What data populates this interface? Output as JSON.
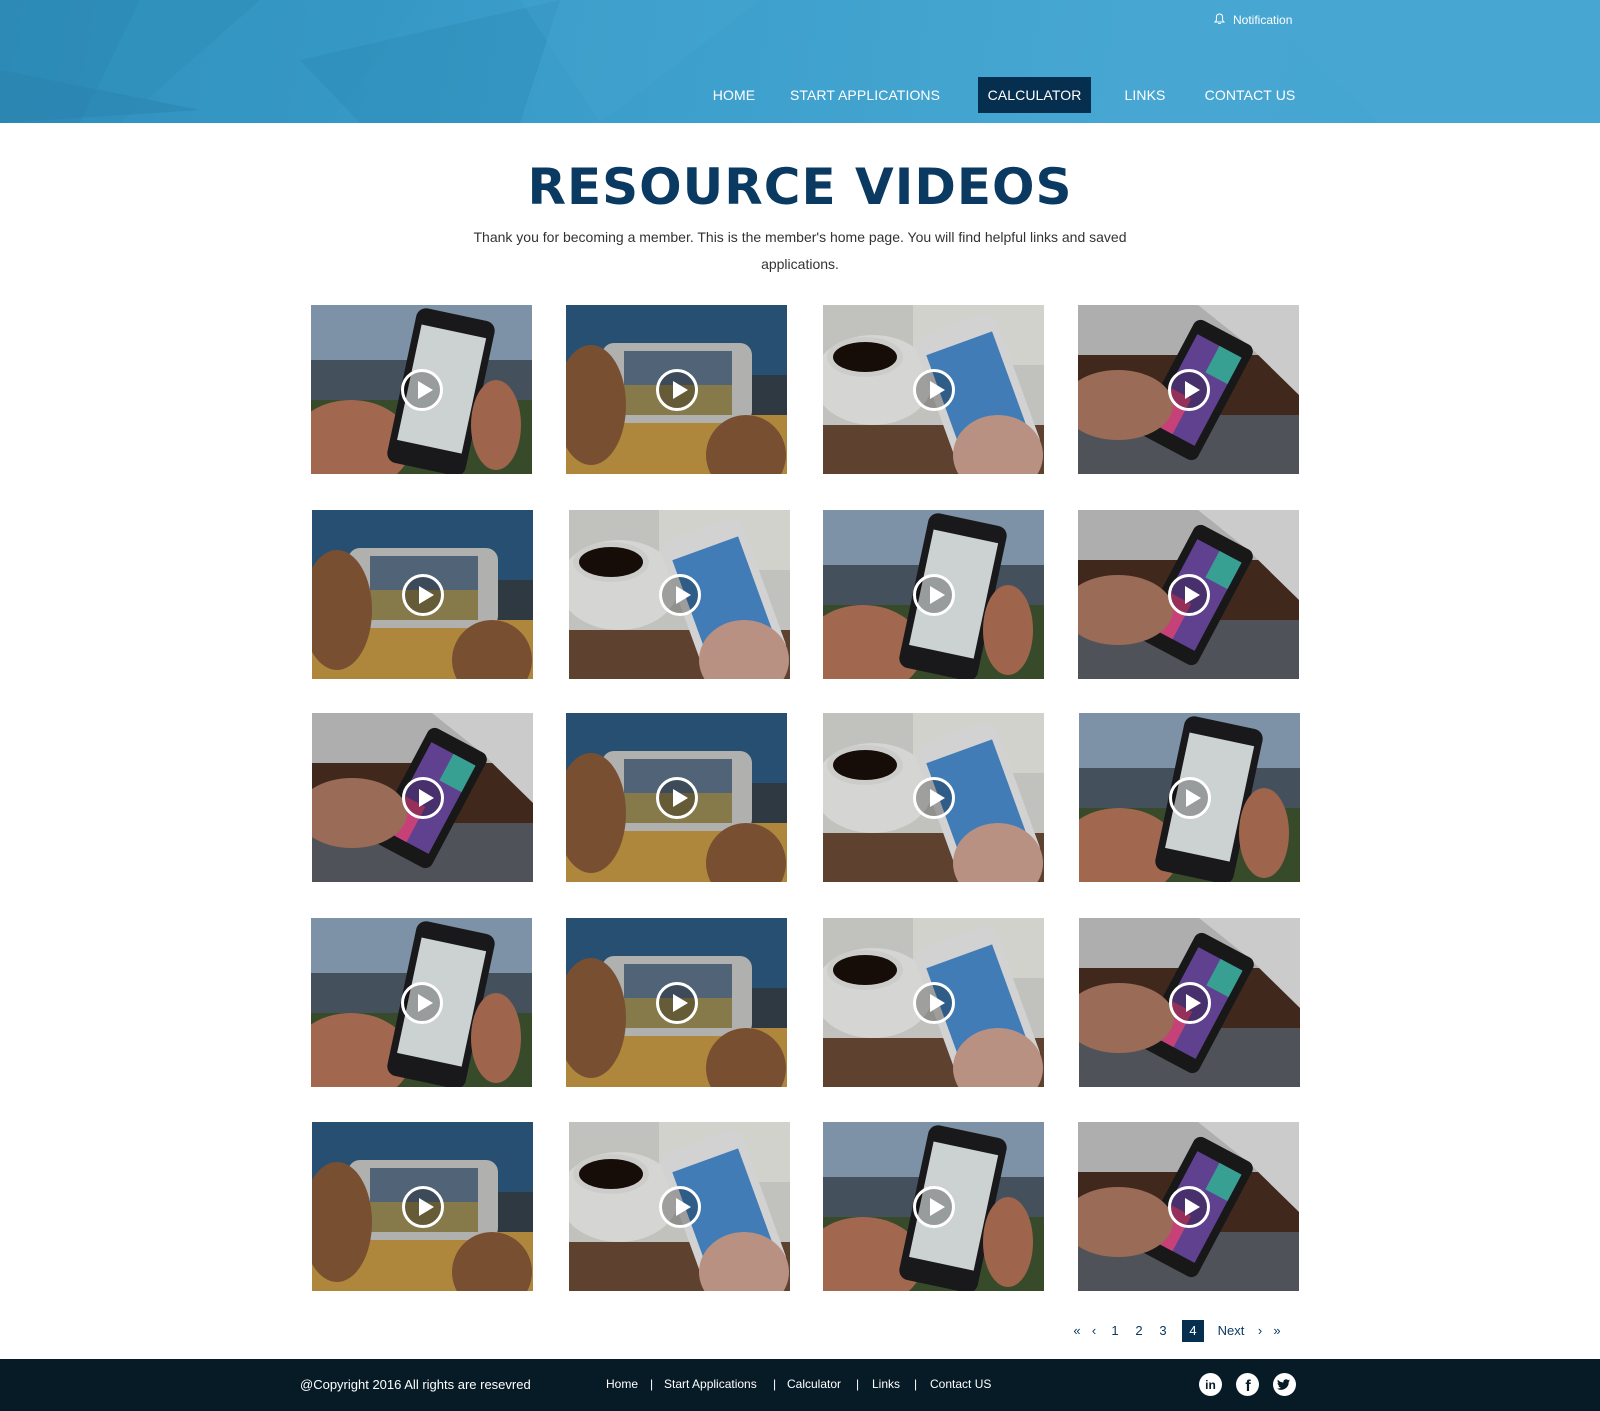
{
  "header": {
    "notification_label": "Notification",
    "nav": [
      {
        "label": "HOME",
        "active": false
      },
      {
        "label": "START APPLICATIONS",
        "active": false
      },
      {
        "label": "CALCULATOR",
        "active": true
      },
      {
        "label": "LINKS",
        "active": false
      },
      {
        "label": "CONTACT US",
        "active": false
      }
    ]
  },
  "main": {
    "title": "RESOURCE VIDEOS",
    "intro": "Thank you for becoming a member. This is the member's home page. You will find helpful links and saved applications.",
    "videos": [
      {
        "scene": "phone-park"
      },
      {
        "scene": "phone-lake"
      },
      {
        "scene": "phone-coffee"
      },
      {
        "scene": "phone-desk"
      },
      {
        "scene": "phone-lake"
      },
      {
        "scene": "phone-coffee"
      },
      {
        "scene": "phone-park"
      },
      {
        "scene": "phone-desk"
      },
      {
        "scene": "phone-desk"
      },
      {
        "scene": "phone-lake"
      },
      {
        "scene": "phone-coffee"
      },
      {
        "scene": "phone-park"
      },
      {
        "scene": "phone-park"
      },
      {
        "scene": "phone-lake"
      },
      {
        "scene": "phone-coffee"
      },
      {
        "scene": "phone-desk"
      },
      {
        "scene": "phone-lake"
      },
      {
        "scene": "phone-coffee"
      },
      {
        "scene": "phone-park"
      },
      {
        "scene": "phone-desk"
      }
    ]
  },
  "pagination": {
    "first": "«",
    "prev": "‹",
    "pages": [
      "1",
      "2",
      "3",
      "4"
    ],
    "current": "4",
    "next_label": "Next",
    "next": "›",
    "last": "»"
  },
  "footer": {
    "copyright": "@Copyright 2016 All rights are resevred",
    "links": [
      "Home",
      "Start Applications",
      "Calculator",
      "Links",
      "Contact US"
    ],
    "separator": "|",
    "social": [
      "linkedin-icon",
      "facebook-icon",
      "twitter-icon"
    ]
  },
  "colors": {
    "header_blue": "#3a9dca",
    "nav_active": "#062f4f",
    "title": "#0a3a62",
    "footer_bg": "#071b27"
  }
}
